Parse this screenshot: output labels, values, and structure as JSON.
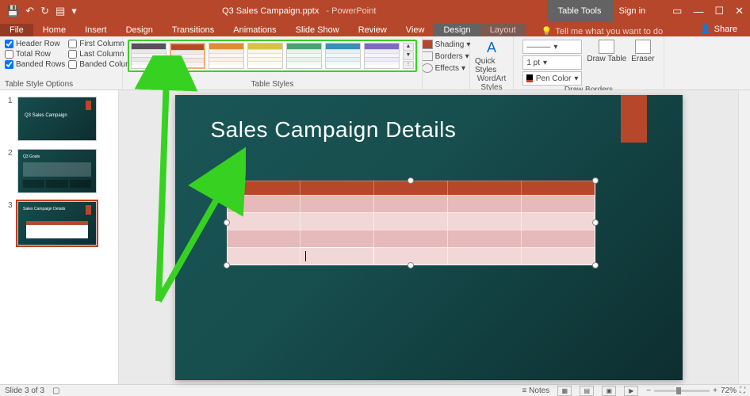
{
  "titlebar": {
    "filename": "Q3 Sales Campaign.pptx",
    "app": "- PowerPoint",
    "context_tab": "Table Tools",
    "signin": "Sign in"
  },
  "tabs": {
    "file": "File",
    "home": "Home",
    "insert": "Insert",
    "design": "Design",
    "transitions": "Transitions",
    "animations": "Animations",
    "slideshow": "Slide Show",
    "review": "Review",
    "view": "View",
    "tt_design": "Design",
    "tt_layout": "Layout",
    "tell": "Tell me what you want to do",
    "share": "Share"
  },
  "ribbon": {
    "tso": {
      "label": "Table Style Options",
      "header_row": "Header Row",
      "total_row": "Total Row",
      "banded_rows": "Banded Rows",
      "first_col": "First Column",
      "last_col": "Last Column",
      "banded_cols": "Banded Columns",
      "checked": {
        "header_row": true,
        "total_row": false,
        "banded_rows": true,
        "first_col": false,
        "last_col": false,
        "banded_cols": false
      }
    },
    "table_styles": {
      "label": "Table Styles",
      "shading": "Shading",
      "borders": "Borders",
      "effects": "Effects",
      "swatch_colors": [
        "#555555",
        "#b7472a",
        "#e08a3c",
        "#d6c24a",
        "#4aa36b",
        "#3b8fb5",
        "#7a6cc0"
      ]
    },
    "wordart": {
      "label": "WordArt Styles",
      "quick": "Quick Styles"
    },
    "draw_borders": {
      "label": "Draw Borders",
      "pen_style": "———",
      "pen_weight": "1 pt",
      "pen_color": "Pen Color",
      "draw_table": "Draw Table",
      "eraser": "Eraser"
    }
  },
  "thumbs": {
    "t1_title": "Q3 Sales Campaign",
    "t2_title": "Q3 Goals",
    "t3_title": "Sales Campaign Details"
  },
  "slide": {
    "title": "Sales Campaign Details"
  },
  "status": {
    "slide_of": "Slide 3 of 3",
    "notes": "Notes",
    "zoom": "72%"
  }
}
